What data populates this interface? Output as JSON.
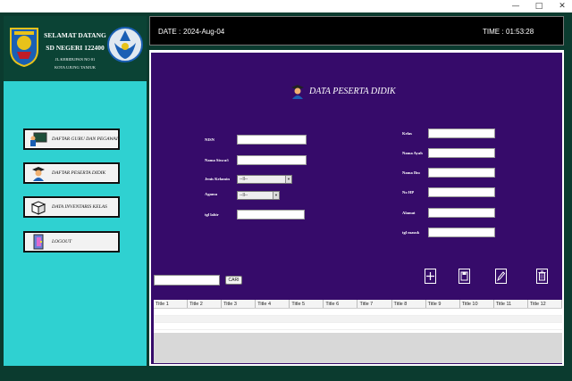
{
  "window": {
    "minimize": "—",
    "maximize": "□",
    "close": "✕"
  },
  "sidebar": {
    "title_line1": "SELAMAT DATANG",
    "title_line2": "SD NEGERI 122400",
    "address_line1": "JL.KERIDUPAN NO 01",
    "address_line2": "KOTA UJUNG TANJUK",
    "menu": [
      {
        "label": "DAFTAR GURU DAN PEGAWAI",
        "icon": "teacher-board-icon"
      },
      {
        "label": "DAFTAR PESERTA DIDIK",
        "icon": "graduate-student-icon"
      },
      {
        "label": "DATA INVENTARIS KELAS",
        "icon": "box-icon"
      },
      {
        "label": "LOGOUT",
        "icon": "door-exit-icon"
      }
    ]
  },
  "header": {
    "date_label": "DATE :",
    "date_value": "2024-Aug-04",
    "time_label": "TIME :",
    "time_value": "01:53:28"
  },
  "main": {
    "title": "DATA PESERTA DIDIK",
    "left_fields": {
      "nisn": {
        "label": "NISN",
        "value": ""
      },
      "nama": {
        "label": "Nama Siswa/i",
        "value": ""
      },
      "jenis_kelamin": {
        "label": "Jenis Kelamin",
        "value": "--Il--"
      },
      "agama": {
        "label": "Agama",
        "value": "--Il--"
      },
      "tgl_lahir": {
        "label": "tgl lahir",
        "value": ""
      }
    },
    "right_fields": {
      "kelas": {
        "label": "Kelas",
        "value": ""
      },
      "ayah": {
        "label": "Nama Ayah",
        "value": ""
      },
      "ibu": {
        "label": "Nama Ibu",
        "value": ""
      },
      "hp": {
        "label": "No HP",
        "value": ""
      },
      "alamat": {
        "label": "Alamat",
        "value": ""
      },
      "tgl_masuk": {
        "label": "tgl masuk",
        "value": ""
      }
    },
    "search": {
      "value": "",
      "button": "CARI"
    },
    "table": {
      "columns": [
        "Title 1",
        "Title 2",
        "Title 3",
        "Title 4",
        "Title 5",
        "Title 6",
        "Title 7",
        "Title 8",
        "Title 9",
        "Title 10",
        "Title 11",
        "Title 12"
      ]
    }
  },
  "colors": {
    "sidebar_bg": "#2fd1d1",
    "frame_bg": "#0b3b2f",
    "main_bg": "#360b6a",
    "header_bg": "#000000"
  }
}
